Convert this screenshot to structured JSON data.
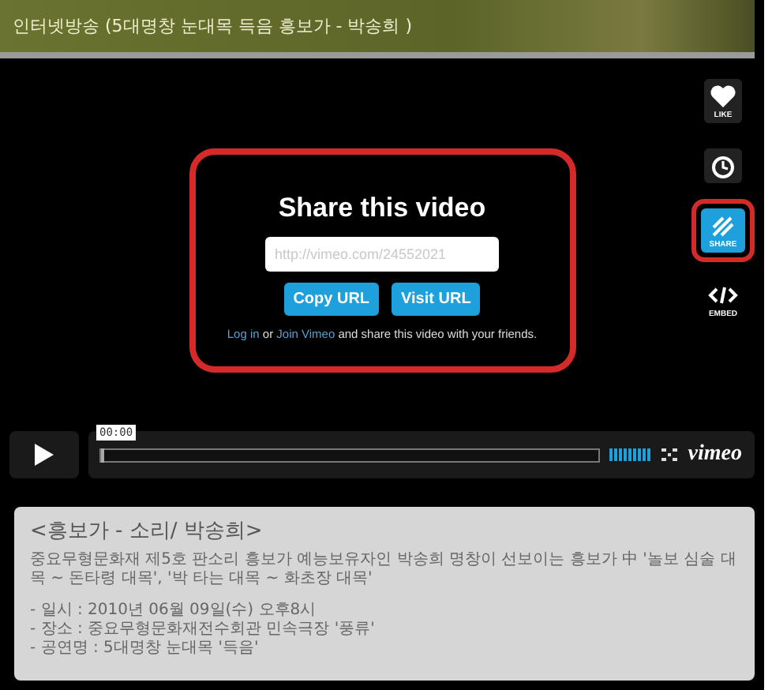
{
  "header": {
    "title": "인터넷방송 (5대명창 눈대목 득음 흥보가 - 박송희 )"
  },
  "side_buttons": [
    {
      "kind": "like",
      "label": "LIKE",
      "selected": false,
      "highlighted": false
    },
    {
      "kind": "later",
      "selected": false,
      "highlighted": false
    },
    {
      "kind": "share",
      "label": "SHARE",
      "selected": true,
      "highlighted": true
    },
    {
      "kind": "embed",
      "label": "EMBED",
      "selected": false,
      "highlighted": false
    }
  ],
  "share_dialog": {
    "highlighted": true,
    "title": "Share this video",
    "url_field": {
      "placeholder": "http://vimeo.com/24552021"
    },
    "buttons": [
      "Copy URL",
      "Visit URL"
    ],
    "note": [
      {
        "kind": "link",
        "text": "Log in"
      },
      {
        "kind": "text",
        "text": " or "
      },
      {
        "kind": "link",
        "text": "Join Vimeo"
      },
      {
        "kind": "text",
        "text": " and share this video with your friends."
      }
    ]
  },
  "player": {
    "time": "00:00",
    "progress": {
      "level": 0
    },
    "volume": {
      "level": 1
    },
    "logo": "vimeo"
  },
  "description": {
    "heading": "<흥보가 - 소리/ 박송희>",
    "paragraph": "중요무형문화재 제5호 판소리 흥보가 예능보유자인 박송희 명창이 선보이는 흥보가 中 '놀보 심술 대목 ~ 돈타령 대목', '박 타는 대목 ~ 화초장 대목'",
    "details": [
      "- 일시 : 2010년 06월 09일(수) 오후8시",
      "- 장소 : 중요무형문화재전수회관 민속극장 '풍류'",
      "- 공연명 : 5대명창 눈대목 '득음'"
    ]
  }
}
